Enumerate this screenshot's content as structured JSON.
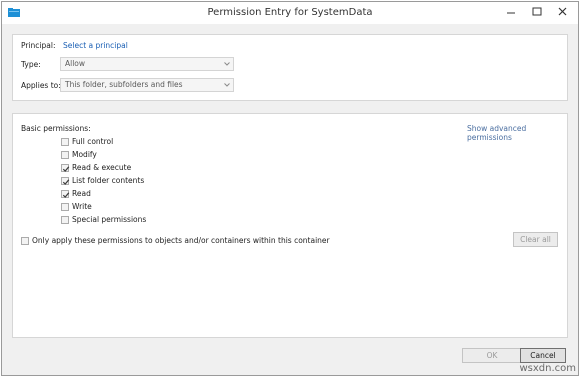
{
  "window": {
    "title": "Permission Entry for SystemData"
  },
  "principal": {
    "label": "Principal:",
    "link": "Select a principal"
  },
  "type": {
    "label": "Type:",
    "value": "Allow"
  },
  "applies_to": {
    "label": "Applies to:",
    "value": "This folder, subfolders and files"
  },
  "basic": {
    "heading": "Basic permissions:",
    "advanced_link": "Show advanced permissions",
    "items": [
      {
        "label": "Full control",
        "checked": false
      },
      {
        "label": "Modify",
        "checked": false
      },
      {
        "label": "Read & execute",
        "checked": true
      },
      {
        "label": "List folder contents",
        "checked": true
      },
      {
        "label": "Read",
        "checked": true
      },
      {
        "label": "Write",
        "checked": false
      },
      {
        "label": "Special permissions",
        "checked": false
      }
    ],
    "only_apply_label": "Only apply these permissions to objects and/or containers within this container",
    "clear_all": "Clear all"
  },
  "footer": {
    "ok": "OK",
    "cancel": "Cancel"
  },
  "watermark": "wsxdn.com"
}
